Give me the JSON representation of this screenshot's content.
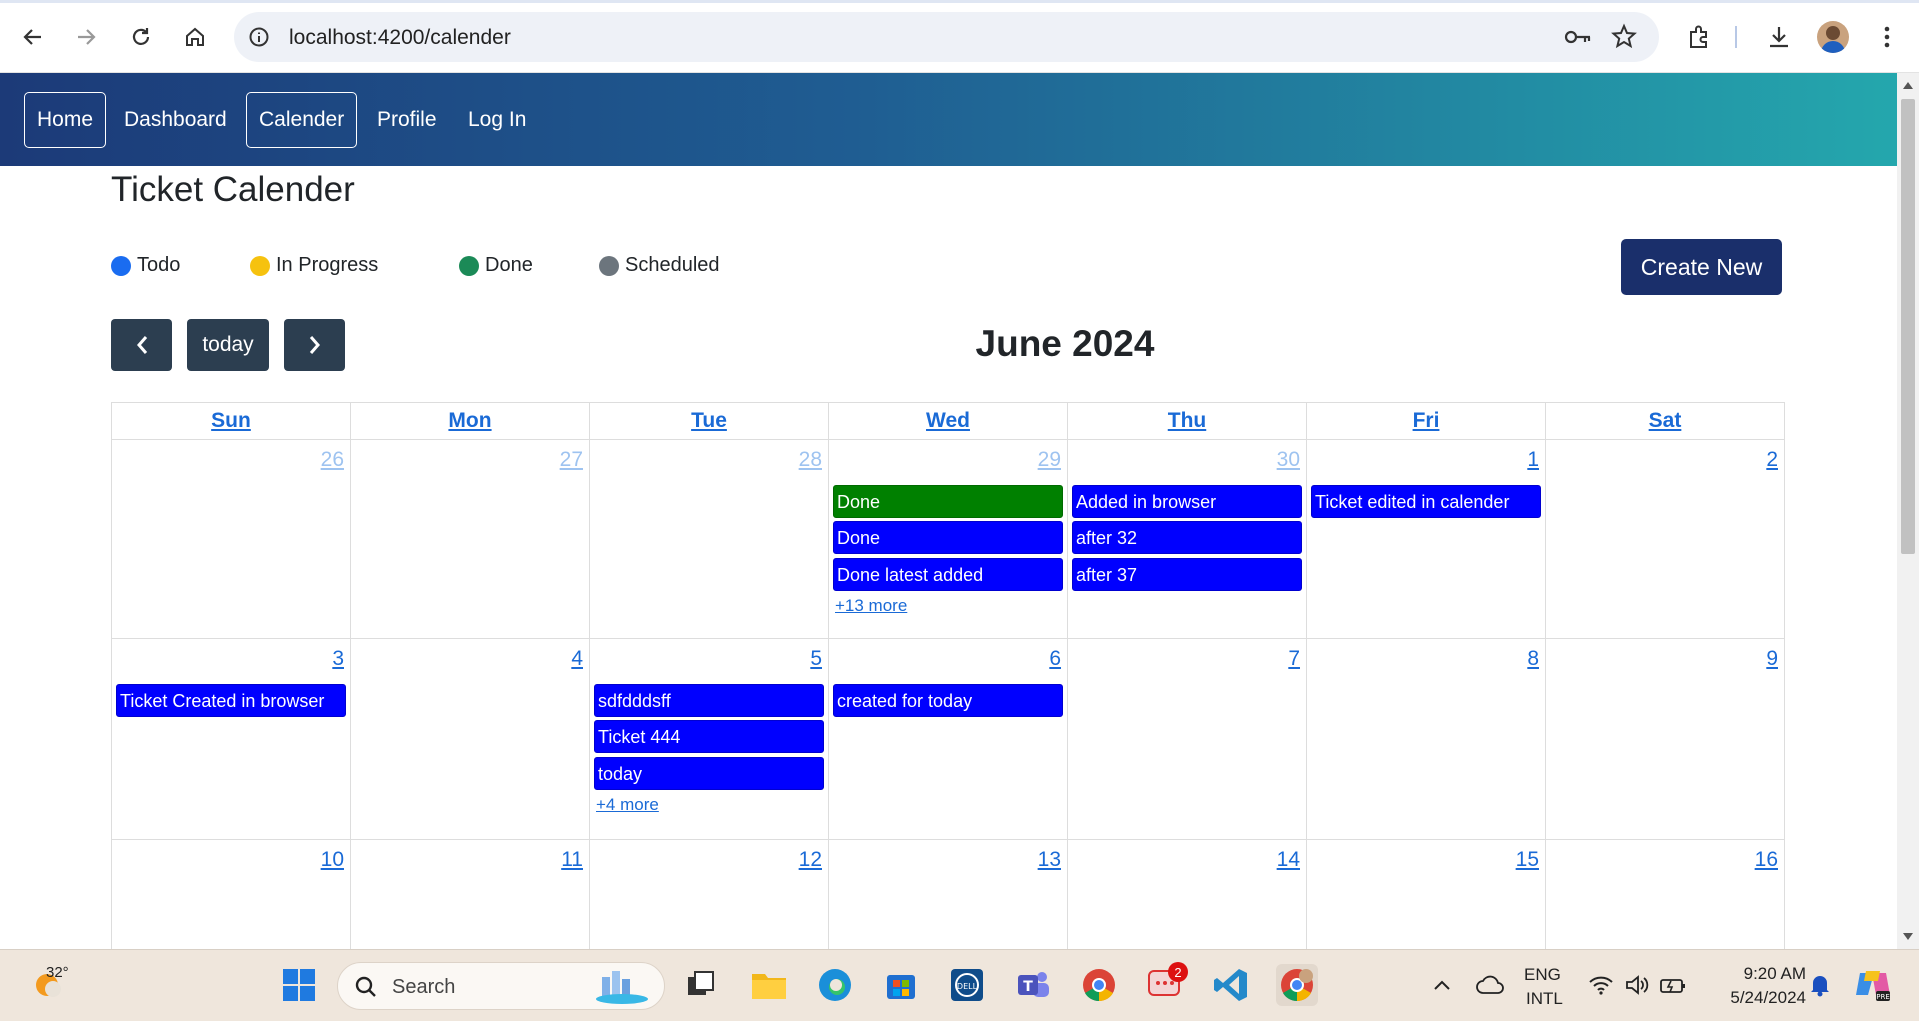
{
  "browser": {
    "url": "localhost:4200/calender",
    "icons": [
      "back-icon",
      "forward-icon",
      "reload-icon",
      "home-icon",
      "info-icon",
      "key-icon",
      "star-icon",
      "extensions-icon",
      "download-icon",
      "profile-avatar",
      "menu-icon"
    ]
  },
  "navbar": {
    "links": [
      {
        "label": "Home",
        "active": true
      },
      {
        "label": "Dashboard",
        "active": false
      },
      {
        "label": "Calender",
        "active": true
      },
      {
        "label": "Profile",
        "active": false
      },
      {
        "label": "Log In",
        "active": false
      }
    ],
    "gradient": [
      "#1c3a78",
      "#24a7ad"
    ]
  },
  "page": {
    "title": "Ticket Calender",
    "create_button": "Create New",
    "legend": [
      {
        "label": "Todo",
        "color": "#1a6cf0"
      },
      {
        "label": "In Progress",
        "color": "#f6c20f"
      },
      {
        "label": "Done",
        "color": "#1b8a57"
      },
      {
        "label": "Scheduled",
        "color": "#6c757d"
      }
    ]
  },
  "calendar": {
    "title": "June 2024",
    "today_label": "today",
    "prev_icon": "chevron-left-icon",
    "next_icon": "chevron-right-icon",
    "days": [
      "Sun",
      "Mon",
      "Tue",
      "Wed",
      "Thu",
      "Fri",
      "Sat"
    ],
    "weeks": [
      {
        "dates": [
          "26",
          "27",
          "28",
          "29",
          "30",
          "1",
          "2"
        ],
        "other": [
          true,
          true,
          true,
          true,
          true,
          false,
          false
        ],
        "events": [
          [],
          [],
          [],
          [
            {
              "title": "Done",
              "status": "done"
            },
            {
              "title": "Done",
              "status": "todo"
            },
            {
              "title": "Done latest added",
              "status": "todo"
            }
          ],
          [
            {
              "title": "Added in browser",
              "status": "todo"
            },
            {
              "title": "after 32",
              "status": "todo"
            },
            {
              "title": "after 37",
              "status": "todo"
            }
          ],
          [
            {
              "title": "Ticket edited in calender",
              "status": "todo"
            }
          ],
          []
        ],
        "more": [
          "",
          "",
          "",
          "+13 more",
          "",
          "",
          ""
        ]
      },
      {
        "dates": [
          "3",
          "4",
          "5",
          "6",
          "7",
          "8",
          "9"
        ],
        "other": [
          false,
          false,
          false,
          false,
          false,
          false,
          false
        ],
        "events": [
          [
            {
              "title": "Ticket Created in browser",
              "status": "todo"
            }
          ],
          [],
          [
            {
              "title": "sdfdddsff",
              "status": "todo"
            },
            {
              "title": "Ticket 444",
              "status": "todo"
            },
            {
              "title": "today",
              "status": "todo"
            }
          ],
          [
            {
              "title": "created for today",
              "status": "todo"
            }
          ],
          [],
          [],
          []
        ],
        "more": [
          "",
          "",
          "+4 more",
          "",
          "",
          "",
          ""
        ]
      },
      {
        "dates": [
          "10",
          "11",
          "12",
          "13",
          "14",
          "15",
          "16"
        ],
        "other": [
          false,
          false,
          false,
          false,
          false,
          false,
          false
        ],
        "events": [
          [],
          [],
          [],
          [],
          [],
          [],
          []
        ],
        "more": [
          "",
          "",
          "",
          "",
          "",
          "",
          ""
        ]
      }
    ]
  },
  "taskbar": {
    "weather_temp": "32°",
    "search_placeholder": "Search",
    "lang_line1": "ENG",
    "lang_line2": "INTL",
    "time": "9:20 AM",
    "date": "5/24/2024",
    "notification_count": "2"
  }
}
